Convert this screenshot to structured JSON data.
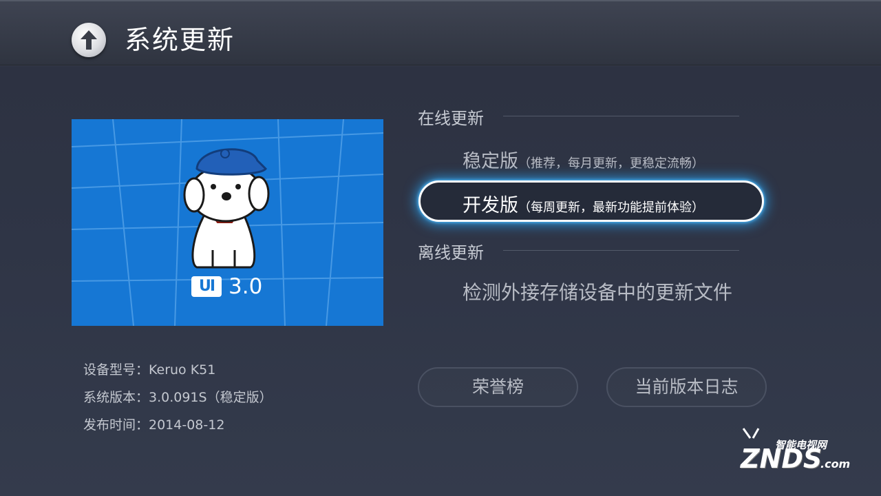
{
  "header": {
    "title": "系统更新",
    "back_icon": "up-arrow-icon"
  },
  "hero": {
    "version": "3.0",
    "logo_text": "UI",
    "background_color": "#1677d4"
  },
  "device_info": {
    "model": "设备型号：Keruo K51",
    "system_version": "系统版本：3.0.091S（稳定版）",
    "release_date": "发布时间：2014-08-12"
  },
  "online_update": {
    "section_title": "在线更新",
    "stable": {
      "label": "稳定版",
      "desc": "（推荐，每月更新，更稳定流畅）"
    },
    "dev": {
      "label": "开发版",
      "desc": "（每周更新，最新功能提前体验）"
    }
  },
  "offline_update": {
    "section_title": "离线更新",
    "scan_label": "检测外接存储设备中的更新文件"
  },
  "buttons": {
    "honor": "荣誉榜",
    "changelog": "当前版本日志"
  },
  "watermark": {
    "top": "智能电视网",
    "main": "ZNDS",
    "suffix": ".com"
  },
  "colors": {
    "focus_glow": "#28aaff",
    "accent_blue": "#1677d4"
  }
}
